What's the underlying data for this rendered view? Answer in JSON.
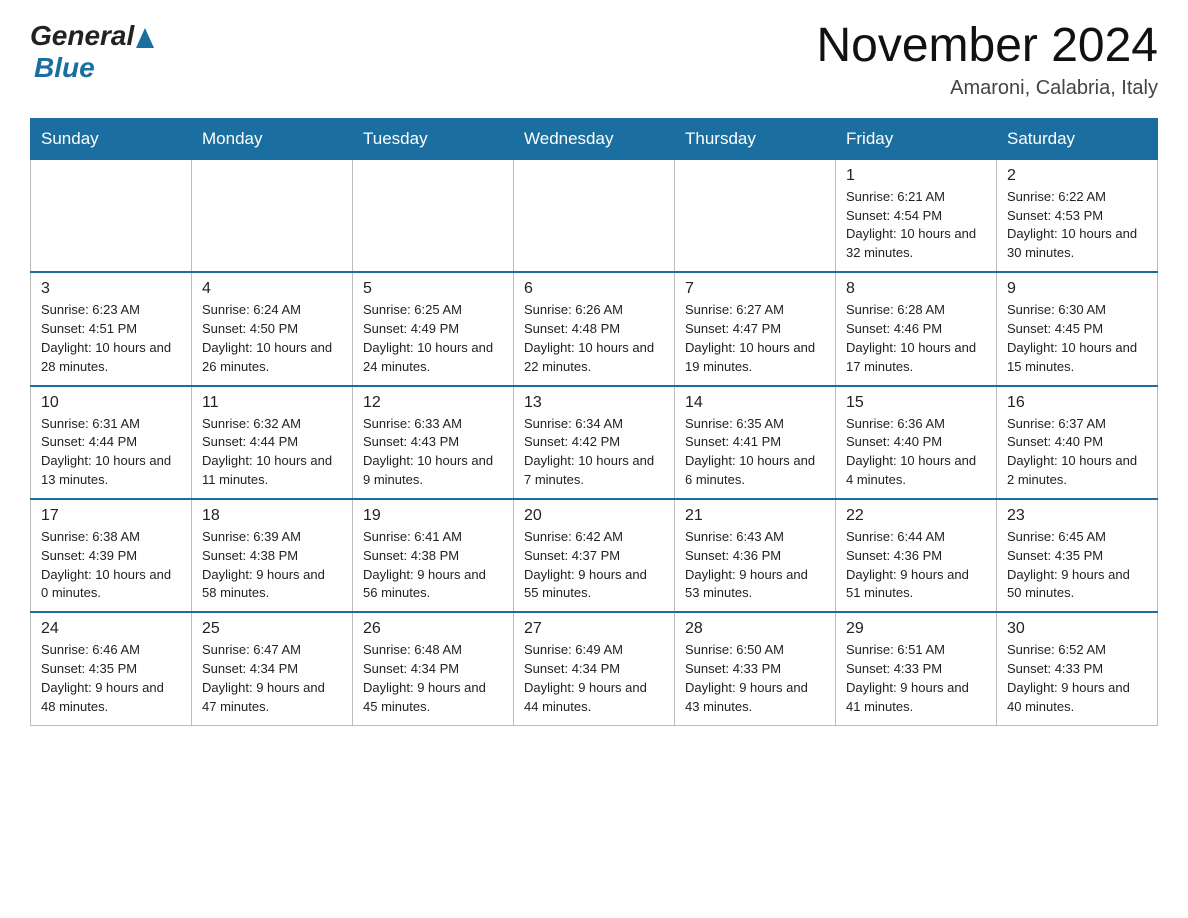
{
  "header": {
    "logo_general": "General",
    "logo_blue": "Blue",
    "month": "November 2024",
    "location": "Amaroni, Calabria, Italy"
  },
  "weekdays": [
    "Sunday",
    "Monday",
    "Tuesday",
    "Wednesday",
    "Thursday",
    "Friday",
    "Saturday"
  ],
  "weeks": [
    [
      {
        "day": "",
        "info": ""
      },
      {
        "day": "",
        "info": ""
      },
      {
        "day": "",
        "info": ""
      },
      {
        "day": "",
        "info": ""
      },
      {
        "day": "",
        "info": ""
      },
      {
        "day": "1",
        "info": "Sunrise: 6:21 AM\nSunset: 4:54 PM\nDaylight: 10 hours and 32 minutes."
      },
      {
        "day": "2",
        "info": "Sunrise: 6:22 AM\nSunset: 4:53 PM\nDaylight: 10 hours and 30 minutes."
      }
    ],
    [
      {
        "day": "3",
        "info": "Sunrise: 6:23 AM\nSunset: 4:51 PM\nDaylight: 10 hours and 28 minutes."
      },
      {
        "day": "4",
        "info": "Sunrise: 6:24 AM\nSunset: 4:50 PM\nDaylight: 10 hours and 26 minutes."
      },
      {
        "day": "5",
        "info": "Sunrise: 6:25 AM\nSunset: 4:49 PM\nDaylight: 10 hours and 24 minutes."
      },
      {
        "day": "6",
        "info": "Sunrise: 6:26 AM\nSunset: 4:48 PM\nDaylight: 10 hours and 22 minutes."
      },
      {
        "day": "7",
        "info": "Sunrise: 6:27 AM\nSunset: 4:47 PM\nDaylight: 10 hours and 19 minutes."
      },
      {
        "day": "8",
        "info": "Sunrise: 6:28 AM\nSunset: 4:46 PM\nDaylight: 10 hours and 17 minutes."
      },
      {
        "day": "9",
        "info": "Sunrise: 6:30 AM\nSunset: 4:45 PM\nDaylight: 10 hours and 15 minutes."
      }
    ],
    [
      {
        "day": "10",
        "info": "Sunrise: 6:31 AM\nSunset: 4:44 PM\nDaylight: 10 hours and 13 minutes."
      },
      {
        "day": "11",
        "info": "Sunrise: 6:32 AM\nSunset: 4:44 PM\nDaylight: 10 hours and 11 minutes."
      },
      {
        "day": "12",
        "info": "Sunrise: 6:33 AM\nSunset: 4:43 PM\nDaylight: 10 hours and 9 minutes."
      },
      {
        "day": "13",
        "info": "Sunrise: 6:34 AM\nSunset: 4:42 PM\nDaylight: 10 hours and 7 minutes."
      },
      {
        "day": "14",
        "info": "Sunrise: 6:35 AM\nSunset: 4:41 PM\nDaylight: 10 hours and 6 minutes."
      },
      {
        "day": "15",
        "info": "Sunrise: 6:36 AM\nSunset: 4:40 PM\nDaylight: 10 hours and 4 minutes."
      },
      {
        "day": "16",
        "info": "Sunrise: 6:37 AM\nSunset: 4:40 PM\nDaylight: 10 hours and 2 minutes."
      }
    ],
    [
      {
        "day": "17",
        "info": "Sunrise: 6:38 AM\nSunset: 4:39 PM\nDaylight: 10 hours and 0 minutes."
      },
      {
        "day": "18",
        "info": "Sunrise: 6:39 AM\nSunset: 4:38 PM\nDaylight: 9 hours and 58 minutes."
      },
      {
        "day": "19",
        "info": "Sunrise: 6:41 AM\nSunset: 4:38 PM\nDaylight: 9 hours and 56 minutes."
      },
      {
        "day": "20",
        "info": "Sunrise: 6:42 AM\nSunset: 4:37 PM\nDaylight: 9 hours and 55 minutes."
      },
      {
        "day": "21",
        "info": "Sunrise: 6:43 AM\nSunset: 4:36 PM\nDaylight: 9 hours and 53 minutes."
      },
      {
        "day": "22",
        "info": "Sunrise: 6:44 AM\nSunset: 4:36 PM\nDaylight: 9 hours and 51 minutes."
      },
      {
        "day": "23",
        "info": "Sunrise: 6:45 AM\nSunset: 4:35 PM\nDaylight: 9 hours and 50 minutes."
      }
    ],
    [
      {
        "day": "24",
        "info": "Sunrise: 6:46 AM\nSunset: 4:35 PM\nDaylight: 9 hours and 48 minutes."
      },
      {
        "day": "25",
        "info": "Sunrise: 6:47 AM\nSunset: 4:34 PM\nDaylight: 9 hours and 47 minutes."
      },
      {
        "day": "26",
        "info": "Sunrise: 6:48 AM\nSunset: 4:34 PM\nDaylight: 9 hours and 45 minutes."
      },
      {
        "day": "27",
        "info": "Sunrise: 6:49 AM\nSunset: 4:34 PM\nDaylight: 9 hours and 44 minutes."
      },
      {
        "day": "28",
        "info": "Sunrise: 6:50 AM\nSunset: 4:33 PM\nDaylight: 9 hours and 43 minutes."
      },
      {
        "day": "29",
        "info": "Sunrise: 6:51 AM\nSunset: 4:33 PM\nDaylight: 9 hours and 41 minutes."
      },
      {
        "day": "30",
        "info": "Sunrise: 6:52 AM\nSunset: 4:33 PM\nDaylight: 9 hours and 40 minutes."
      }
    ]
  ]
}
